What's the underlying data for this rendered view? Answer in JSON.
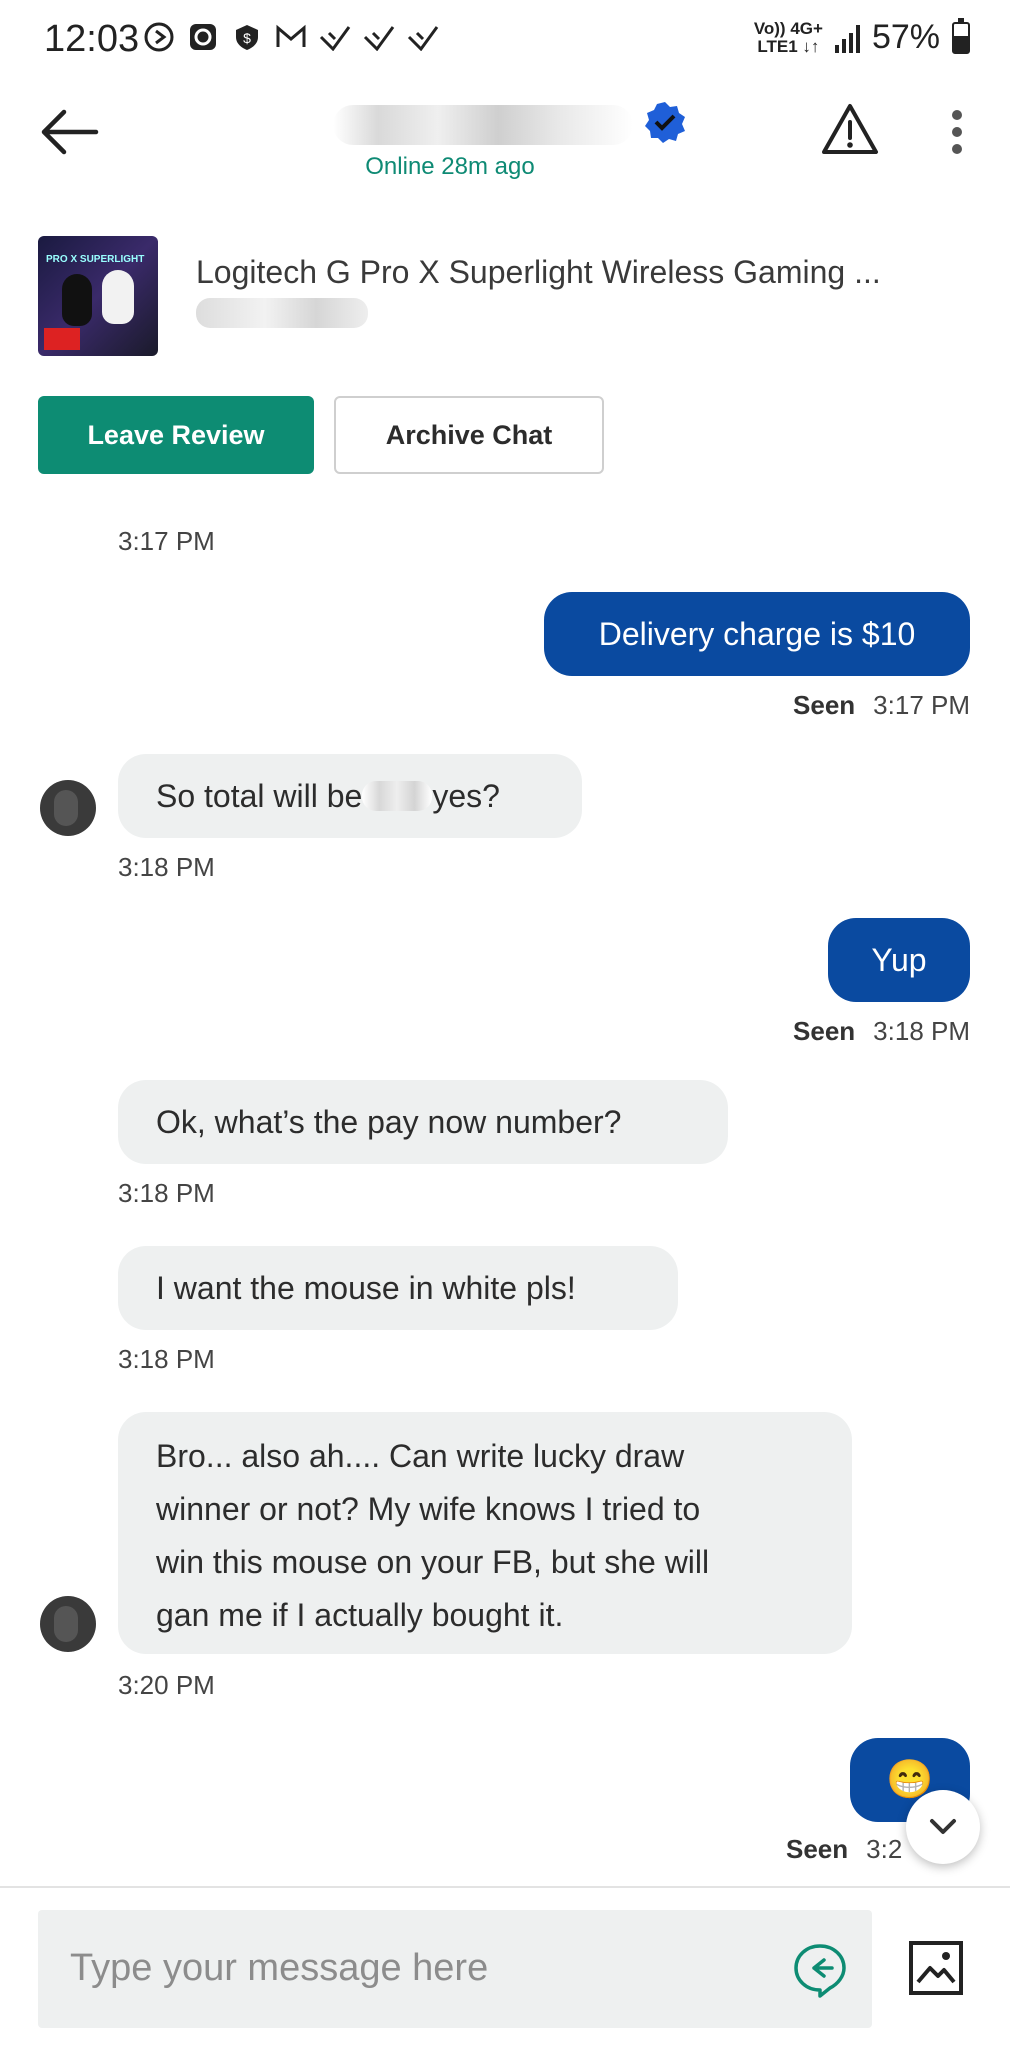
{
  "status_bar": {
    "time": "12:03",
    "network_top": "Vo)) 4G+",
    "network_bottom": "LTE1 ↓↑",
    "battery": "57%",
    "battery_level": 0.57
  },
  "header": {
    "status": "Online 28m ago"
  },
  "listing": {
    "title": "Logitech G Pro X Superlight Wireless Gaming ..."
  },
  "actions": {
    "leave_review": "Leave Review",
    "archive_chat": "Archive Chat"
  },
  "messages": [
    {
      "id": "m0",
      "direction": "in",
      "time": "3:17 PM"
    },
    {
      "id": "m1",
      "direction": "out",
      "text": "Delivery charge is $10",
      "seen": "Seen",
      "time": "3:17 PM"
    },
    {
      "id": "m2",
      "direction": "in",
      "text_before": "So total will be",
      "text_after": "yes?",
      "time": "3:18 PM"
    },
    {
      "id": "m3",
      "direction": "out",
      "text": "Yup",
      "seen": "Seen",
      "time": "3:18 PM"
    },
    {
      "id": "m4",
      "direction": "in",
      "text": "Ok, what’s the pay now number?",
      "time": "3:18 PM"
    },
    {
      "id": "m5",
      "direction": "in",
      "text": "I want the mouse in white pls!",
      "time": "3:18 PM"
    },
    {
      "id": "m6",
      "direction": "in",
      "lines": [
        "Bro... also ah.... Can write lucky draw",
        "winner or not? My wife knows I tried to",
        "win this mouse on your FB, but she will",
        "gan me if I actually bought it."
      ],
      "time": "3:20 PM"
    },
    {
      "id": "m7",
      "direction": "out",
      "text": "😁",
      "seen": "Seen",
      "time": "3:2"
    }
  ],
  "composer": {
    "placeholder": "Type your message here"
  },
  "colors": {
    "brand_green": "#0d8c73",
    "outgoing_bubble": "#0a4aa0",
    "incoming_bubble": "#eef0f0",
    "online_text": "#0e8a74"
  }
}
